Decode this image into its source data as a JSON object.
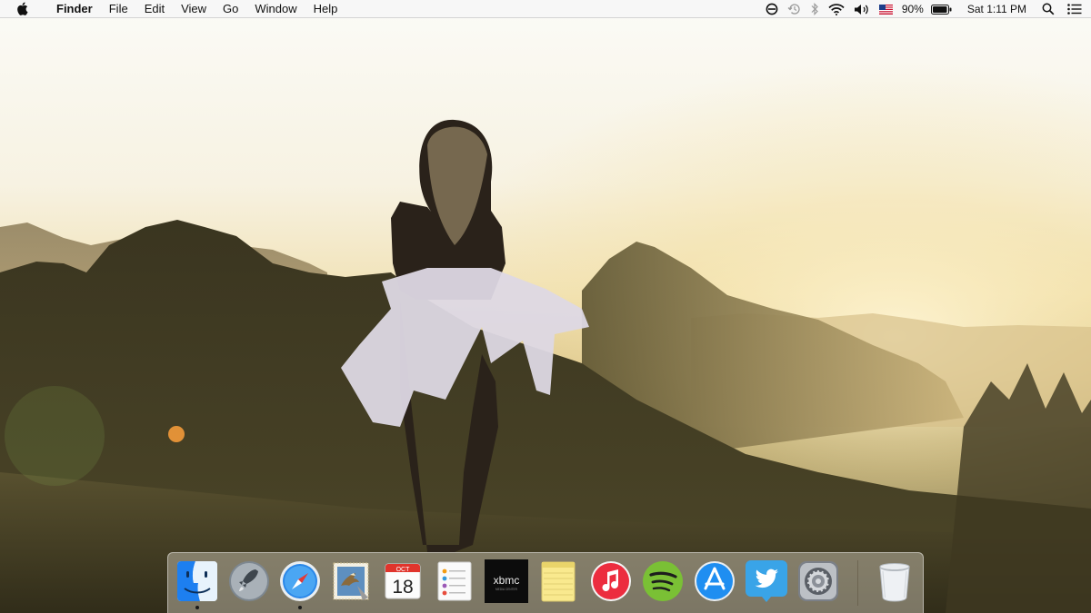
{
  "menubar": {
    "app_name": "Finder",
    "menus": [
      "File",
      "Edit",
      "View",
      "Go",
      "Window",
      "Help"
    ],
    "battery_percent": "90%",
    "clock": "Sat 1:11 PM",
    "status_icons": [
      "do-not-disturb-icon",
      "time-machine-icon",
      "bluetooth-icon",
      "wifi-icon",
      "volume-icon",
      "us-flag-icon",
      "battery-icon",
      "spotlight-icon",
      "notification-center-icon"
    ]
  },
  "dock": {
    "apps": [
      {
        "name": "Finder",
        "icon": "finder-icon",
        "running": true
      },
      {
        "name": "Launchpad",
        "icon": "launchpad-icon",
        "running": false
      },
      {
        "name": "Safari",
        "icon": "safari-icon",
        "running": true
      },
      {
        "name": "Mail",
        "icon": "mail-icon",
        "running": false
      },
      {
        "name": "Calendar",
        "icon": "calendar-icon",
        "running": false,
        "month": "OCT",
        "day": "18"
      },
      {
        "name": "Reminders",
        "icon": "reminders-icon",
        "running": false
      },
      {
        "name": "XBMC",
        "icon": "xbmc-icon",
        "running": false,
        "label": "xbmc",
        "sublabel": "MEDIA CENTER"
      },
      {
        "name": "Notes",
        "icon": "notes-icon",
        "running": false
      },
      {
        "name": "iTunes",
        "icon": "itunes-icon",
        "running": false
      },
      {
        "name": "Spotify",
        "icon": "spotify-icon",
        "running": false
      },
      {
        "name": "App Store",
        "icon": "app-store-icon",
        "running": false
      },
      {
        "name": "Twitter",
        "icon": "twitter-icon",
        "running": false
      },
      {
        "name": "System Preferences",
        "icon": "system-preferences-icon",
        "running": false
      },
      {
        "name": "Trash",
        "icon": "trash-icon",
        "running": false
      }
    ]
  },
  "colors": {
    "menubar_bg": "#f6f6f6",
    "sky": "#fbfbf7",
    "mountain": "#4a4228",
    "sun_glow": "#f7e9b8"
  }
}
